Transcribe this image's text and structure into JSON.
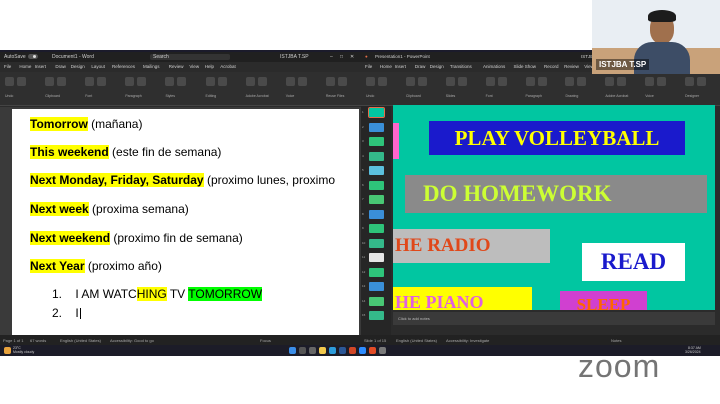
{
  "word": {
    "title": {
      "autosave": "AutoSave",
      "doc_name": "Document1 - Word",
      "user": "ISTJBA T.SP",
      "search": "Search"
    },
    "menu": [
      "File",
      "Home",
      "Insert",
      "Draw",
      "Design",
      "Layout",
      "References",
      "Mailings",
      "Review",
      "View",
      "Help",
      "Acrobat"
    ],
    "ribbon_groups": [
      "Undo",
      "Clipboard",
      "Font",
      "Paragraph",
      "Styles",
      "Editing",
      "Adobe Acrobat",
      "Voice",
      "Reuse Files"
    ],
    "lines": [
      {
        "key": "Tomorrow",
        "rest": " (mañana)"
      },
      {
        "key": "This weekend",
        "rest": " (este fin de semana)"
      },
      {
        "key": "Next Monday, Friday, Saturday",
        "rest": " (proximo lunes, proximo"
      },
      {
        "key": "Next week",
        "rest": " (proxima semana)"
      },
      {
        "key": "Next weekend",
        "rest": " (proximo fin de semana)"
      },
      {
        "key": "Next Year",
        "rest": " (proximo año)"
      }
    ],
    "list": [
      {
        "num": "1.",
        "text_a": "I AM WATC",
        "text_b": "HING",
        "text_c": " TV ",
        "text_d": "TOMORROW"
      },
      {
        "num": "2.",
        "text_a": "I"
      }
    ],
    "status": {
      "page": "Page 1 of 1",
      "words": "67 words",
      "language": "English (United States)",
      "accessibility": "Accessibility: Good to go",
      "focus": "Focus"
    }
  },
  "ppt": {
    "title": {
      "doc_name": "Presentation1 - PowerPoint",
      "user": "ISTJBA T.SP"
    },
    "menu": [
      "File",
      "Home",
      "Insert",
      "Draw",
      "Design",
      "Transitions",
      "Animations",
      "Slide Show",
      "Record",
      "Review",
      "View",
      "Add-ins",
      "Help",
      "Acrobat"
    ],
    "ribbon_groups": [
      "Undo",
      "Clipboard",
      "Slides",
      "Font",
      "Paragraph",
      "Drawing",
      "Adobe Acrobat",
      "Voice",
      "Designer"
    ],
    "slide_numbers": [
      "1",
      "2",
      "3",
      "4",
      "5",
      "6",
      "7",
      "8",
      "9",
      "10",
      "11",
      "12",
      "13",
      "14",
      "15"
    ],
    "slide_boxes": {
      "play_volleyball": "PLAY VOLLEYBALL",
      "do_homework": "DO HOMEWORK",
      "the_radio": "HE RADIO",
      "read": "READ",
      "the_piano": "HE PIANO",
      "sleep": "SLEEP"
    },
    "notes": "Click to add notes",
    "status": {
      "slide": "Slide 1 of 15",
      "language": "English (United States)",
      "accessibility": "Accessibility: Investigate",
      "notes": "Notes"
    }
  },
  "taskbar": {
    "weather": "23°C",
    "weather_desc": "Mostly cloudy",
    "time": "8:37 AM",
    "date": "3/26/2024"
  },
  "webcam": {
    "name": "ISTJBA T.SP"
  },
  "zoom": {
    "logo": "zoom"
  }
}
